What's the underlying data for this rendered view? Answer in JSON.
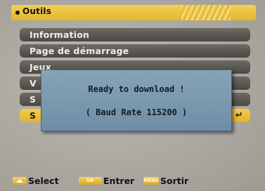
{
  "header": {
    "title": "Outils"
  },
  "menu": {
    "items": [
      {
        "label": "Information"
      },
      {
        "label": "Page de démarrage"
      },
      {
        "label": "Jeux"
      },
      {
        "label": "V"
      },
      {
        "label": "S"
      },
      {
        "label": "S",
        "selected": true
      }
    ]
  },
  "dialog": {
    "line1": "Ready to download !",
    "line2": "( Baud Rate 115200 )"
  },
  "footer": {
    "select_label": "Select",
    "enter_key": "OK",
    "enter_label": "Entrer",
    "exit_key": "MENU",
    "exit_label": "Sortir"
  },
  "colors": {
    "accent": "#e9bc36",
    "item_bg": "#5a5650",
    "dialog_bg": "#7896ad"
  }
}
